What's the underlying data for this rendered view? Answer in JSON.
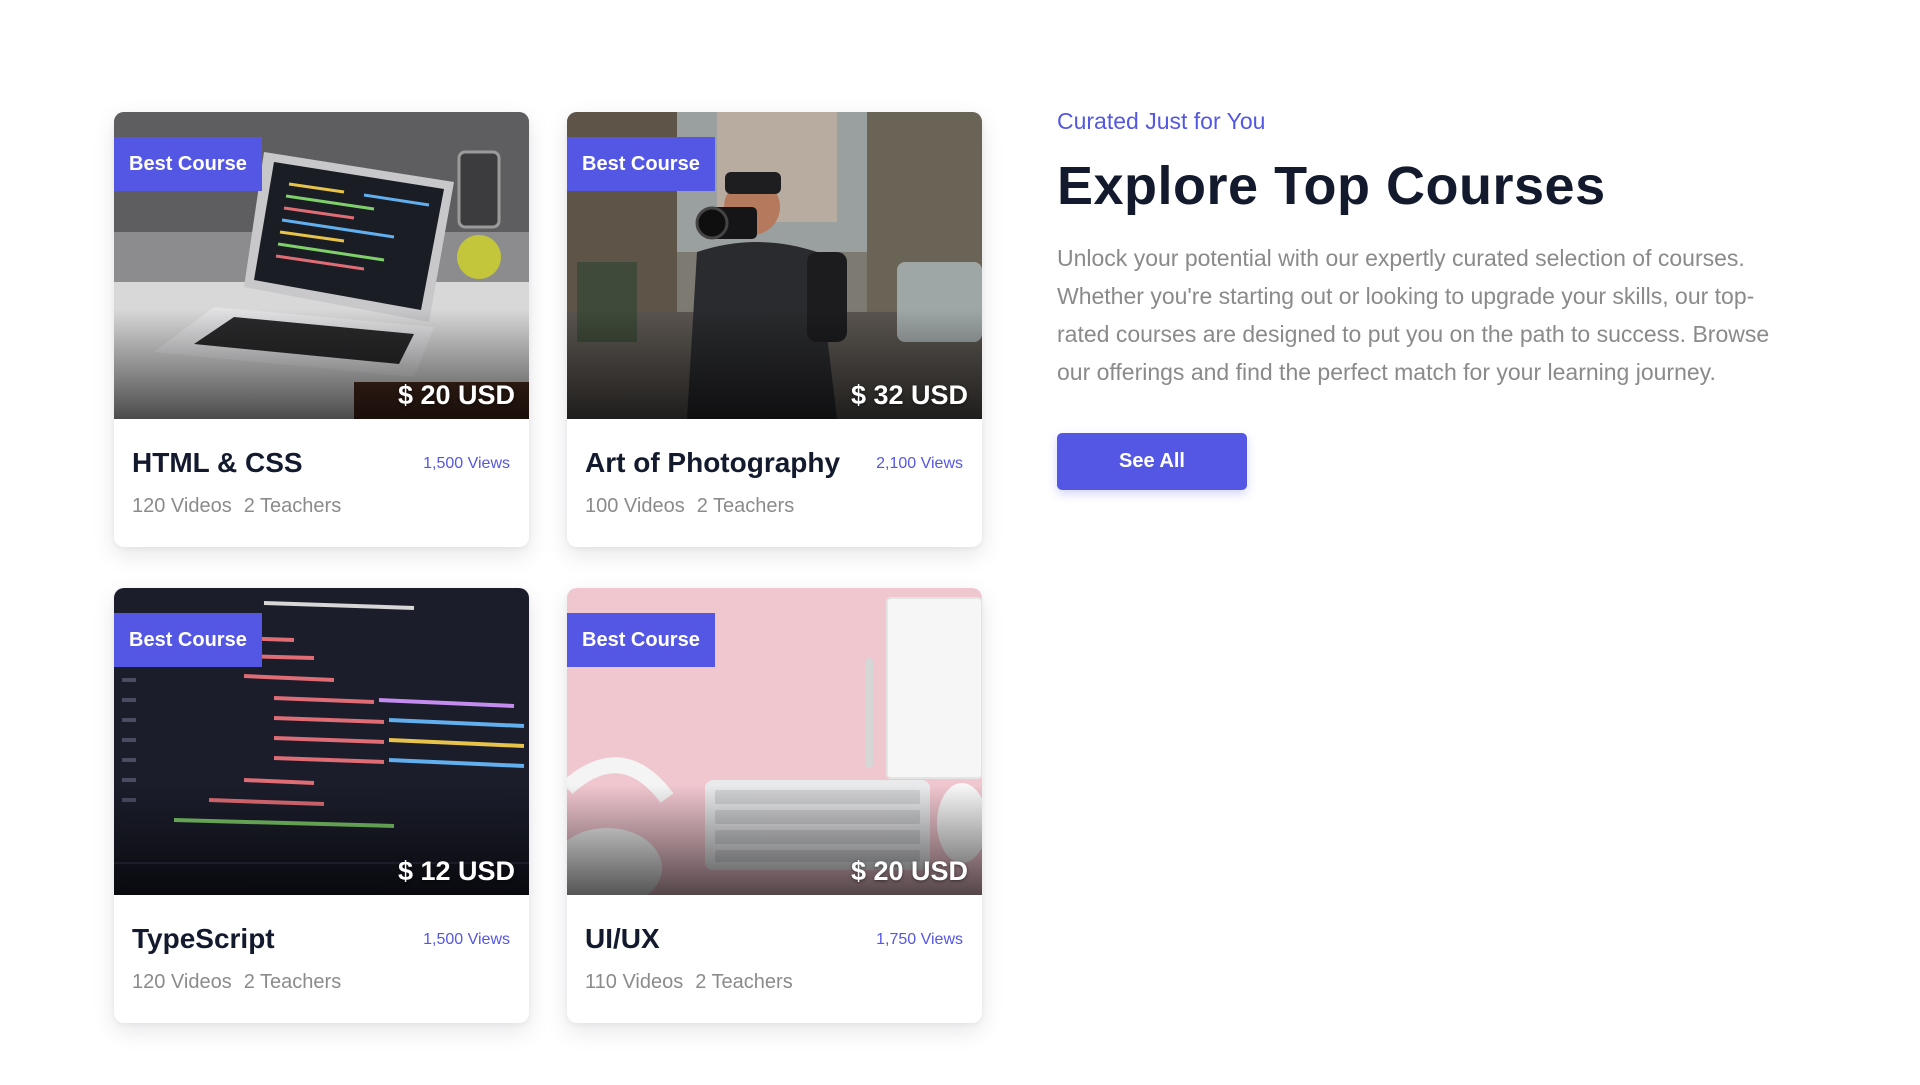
{
  "section": {
    "eyebrow": "Curated Just for You",
    "heading": "Explore Top Courses",
    "description": "Unlock your potential with our expertly curated selection of courses. Whether you're starting out or looking to upgrade your skills, our top-rated courses are designed to put you on the path to success. Browse our offerings and find the perfect match for your learning journey.",
    "button_label": "See All"
  },
  "courses": [
    {
      "badge": "Best Course",
      "price": "$ 20 USD",
      "title": "HTML & CSS",
      "views": "1,500 Views",
      "videos": "120 Videos",
      "teachers": "2 Teachers"
    },
    {
      "badge": "Best Course",
      "price": "$ 32 USD",
      "title": "Art of Photography",
      "views": "2,100 Views",
      "videos": "100 Videos",
      "teachers": "2 Teachers"
    },
    {
      "badge": "Best Course",
      "price": "$ 12 USD",
      "title": "TypeScript",
      "views": "1,500 Views",
      "videos": "120 Videos",
      "teachers": "2 Teachers"
    },
    {
      "badge": "Best Course",
      "price": "$ 20 USD",
      "title": "UI/UX",
      "views": "1,750 Views",
      "videos": "110 Videos",
      "teachers": "2 Teachers"
    }
  ],
  "colors": {
    "accent": "#5457e4",
    "heading": "#141a2e",
    "muted": "#8a8a8a"
  }
}
